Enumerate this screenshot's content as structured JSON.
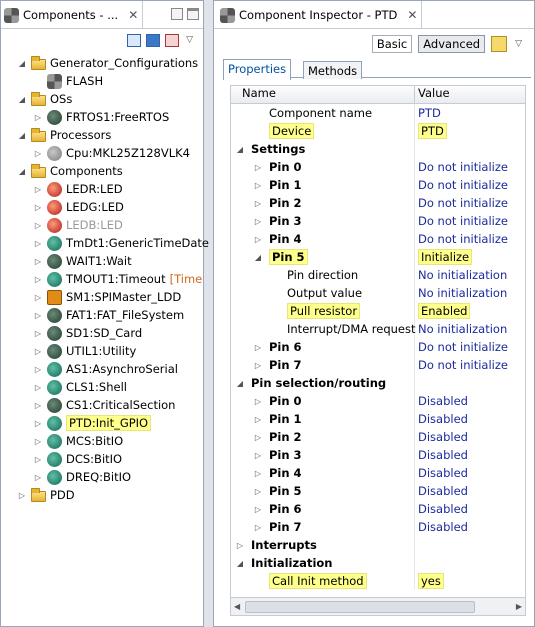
{
  "left_panel": {
    "tab_title": "Components - ...",
    "tree": [
      {
        "level": 0,
        "twisty": "open",
        "icon": "folder",
        "label": "Generator_Configurations"
      },
      {
        "level": 1,
        "twisty": "none",
        "icon": "gear",
        "label": "FLASH"
      },
      {
        "level": 0,
        "twisty": "open",
        "icon": "folder",
        "label": "OSs"
      },
      {
        "level": 1,
        "twisty": "closed",
        "icon": "dark",
        "label": "FRTOS1:FreeRTOS"
      },
      {
        "level": 0,
        "twisty": "open",
        "icon": "folder",
        "label": "Processors"
      },
      {
        "level": 1,
        "twisty": "closed",
        "icon": "grey",
        "label": "Cpu:MKL25Z128VLK4"
      },
      {
        "level": 0,
        "twisty": "open",
        "icon": "folder",
        "label": "Components"
      },
      {
        "level": 1,
        "twisty": "closed",
        "icon": "red",
        "label": "LEDR:LED"
      },
      {
        "level": 1,
        "twisty": "closed",
        "icon": "red",
        "label": "LEDG:LED"
      },
      {
        "level": 1,
        "twisty": "closed",
        "icon": "red",
        "label": "LEDB:LED",
        "dim": true
      },
      {
        "level": 1,
        "twisty": "closed",
        "icon": "teal",
        "label": "TmDt1:GenericTimeDate"
      },
      {
        "level": 1,
        "twisty": "closed",
        "icon": "dark",
        "label": "WAIT1:Wait"
      },
      {
        "level": 1,
        "twisty": "closed",
        "icon": "teal",
        "label": "TMOUT1:Timeout",
        "suffix": "[Time"
      },
      {
        "level": 1,
        "twisty": "closed",
        "icon": "sq",
        "label": "SM1:SPIMaster_LDD"
      },
      {
        "level": 1,
        "twisty": "closed",
        "icon": "dark",
        "label": "FAT1:FAT_FileSystem"
      },
      {
        "level": 1,
        "twisty": "closed",
        "icon": "dark",
        "label": "SD1:SD_Card"
      },
      {
        "level": 1,
        "twisty": "closed",
        "icon": "dark",
        "label": "UTIL1:Utility"
      },
      {
        "level": 1,
        "twisty": "closed",
        "icon": "teal",
        "label": "AS1:AsynchroSerial"
      },
      {
        "level": 1,
        "twisty": "closed",
        "icon": "teal",
        "label": "CLS1:Shell"
      },
      {
        "level": 1,
        "twisty": "closed",
        "icon": "dark",
        "label": "CS1:CriticalSection"
      },
      {
        "level": 1,
        "twisty": "closed",
        "icon": "teal",
        "label": "PTD:Init_GPIO",
        "highlight": true
      },
      {
        "level": 1,
        "twisty": "closed",
        "icon": "teal",
        "label": "MCS:BitIO"
      },
      {
        "level": 1,
        "twisty": "closed",
        "icon": "teal",
        "label": "DCS:BitIO"
      },
      {
        "level": 1,
        "twisty": "closed",
        "icon": "teal",
        "label": "DREQ:BitIO"
      },
      {
        "level": 0,
        "twisty": "closed",
        "icon": "folder",
        "label": "PDD"
      }
    ]
  },
  "inspector": {
    "tab_title": "Component Inspector - PTD",
    "mode_basic": "Basic",
    "mode_advanced": "Advanced",
    "tab_properties": "Properties",
    "tab_methods": "Methods",
    "col_name": "Name",
    "col_value": "Value",
    "rows": [
      {
        "level": 1,
        "twisty": "none",
        "name": "Component name",
        "value": "PTD"
      },
      {
        "level": 1,
        "twisty": "none",
        "name": "Device",
        "value": "PTD",
        "hl": true
      },
      {
        "level": 0,
        "twisty": "open",
        "name": "Settings",
        "value": "",
        "bold": true
      },
      {
        "level": 1,
        "twisty": "closed",
        "name": "Pin 0",
        "value": "Do not initialize",
        "bold": true
      },
      {
        "level": 1,
        "twisty": "closed",
        "name": "Pin 1",
        "value": "Do not initialize",
        "bold": true
      },
      {
        "level": 1,
        "twisty": "closed",
        "name": "Pin 2",
        "value": "Do not initialize",
        "bold": true
      },
      {
        "level": 1,
        "twisty": "closed",
        "name": "Pin 3",
        "value": "Do not initialize",
        "bold": true
      },
      {
        "level": 1,
        "twisty": "closed",
        "name": "Pin 4",
        "value": "Do not initialize",
        "bold": true
      },
      {
        "level": 1,
        "twisty": "open",
        "name": "Pin 5",
        "value": "Initialize",
        "bold": true,
        "hl": true
      },
      {
        "level": 2,
        "twisty": "none",
        "name": "Pin direction",
        "value": "No initialization"
      },
      {
        "level": 2,
        "twisty": "none",
        "name": "Output value",
        "value": "No initialization"
      },
      {
        "level": 2,
        "twisty": "none",
        "name": "Pull resistor",
        "value": "Enabled",
        "hl": true
      },
      {
        "level": 2,
        "twisty": "none",
        "name": "Interrupt/DMA request",
        "value": "No initialization"
      },
      {
        "level": 1,
        "twisty": "closed",
        "name": "Pin 6",
        "value": "Do not initialize",
        "bold": true
      },
      {
        "level": 1,
        "twisty": "closed",
        "name": "Pin 7",
        "value": "Do not initialize",
        "bold": true
      },
      {
        "level": 0,
        "twisty": "open",
        "name": "Pin selection/routing",
        "value": "",
        "bold": true
      },
      {
        "level": 1,
        "twisty": "closed",
        "name": "Pin 0",
        "value": "Disabled",
        "bold": true
      },
      {
        "level": 1,
        "twisty": "closed",
        "name": "Pin 1",
        "value": "Disabled",
        "bold": true
      },
      {
        "level": 1,
        "twisty": "closed",
        "name": "Pin 2",
        "value": "Disabled",
        "bold": true
      },
      {
        "level": 1,
        "twisty": "closed",
        "name": "Pin 3",
        "value": "Disabled",
        "bold": true
      },
      {
        "level": 1,
        "twisty": "closed",
        "name": "Pin 4",
        "value": "Disabled",
        "bold": true
      },
      {
        "level": 1,
        "twisty": "closed",
        "name": "Pin 5",
        "value": "Disabled",
        "bold": true
      },
      {
        "level": 1,
        "twisty": "closed",
        "name": "Pin 6",
        "value": "Disabled",
        "bold": true
      },
      {
        "level": 1,
        "twisty": "closed",
        "name": "Pin 7",
        "value": "Disabled",
        "bold": true
      },
      {
        "level": 0,
        "twisty": "closed",
        "name": "Interrupts",
        "value": "",
        "bold": true
      },
      {
        "level": 0,
        "twisty": "open",
        "name": "Initialization",
        "value": "",
        "bold": true
      },
      {
        "level": 1,
        "twisty": "none",
        "name": "Call Init method",
        "value": "yes",
        "hl": true
      }
    ]
  }
}
